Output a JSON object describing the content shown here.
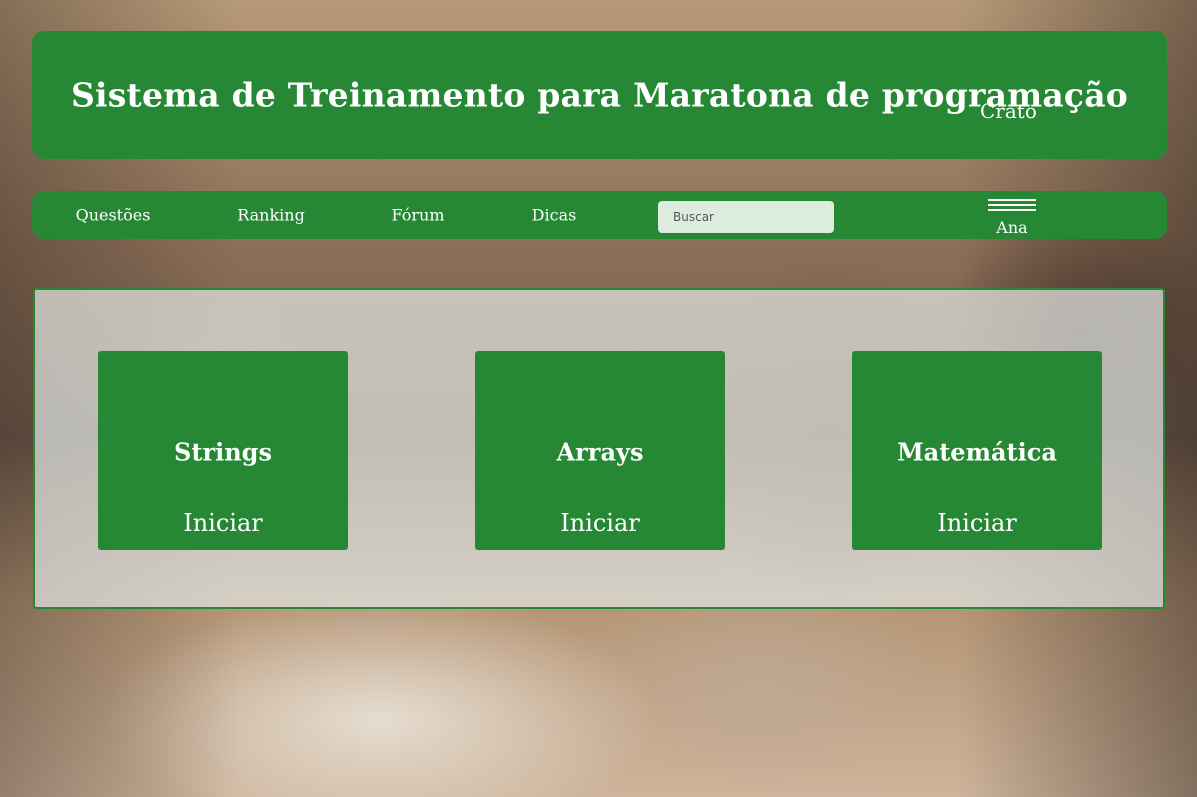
{
  "header": {
    "title": "Sistema de Treinamento para Maratona de programação",
    "subtitle": "Crato"
  },
  "nav": {
    "links": [
      "Questões",
      "Ranking",
      "Fórum",
      "Dicas"
    ],
    "search_placeholder": "Buscar",
    "user_name": "Ana",
    "menu_icon": "hamburger-icon"
  },
  "cards": [
    {
      "title": "Strings",
      "action": "Iniciar"
    },
    {
      "title": "Arrays",
      "action": "Iniciar"
    },
    {
      "title": "Matemática",
      "action": "Iniciar"
    }
  ],
  "colors": {
    "primary_green": "#268834",
    "panel_overlay": "#e1e4e2",
    "search_bg": "#dcede0",
    "text_on_green": "#ffffff"
  }
}
